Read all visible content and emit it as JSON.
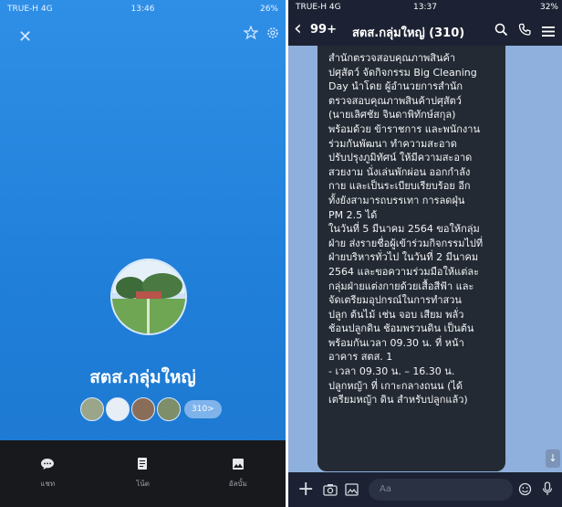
{
  "left": {
    "status": {
      "carrier": "TRUE-H 4G",
      "time": "13:46",
      "battery": "26%"
    },
    "group_name": "สตส.กลุ่มใหญ่",
    "member_count": "310>",
    "bottom_tabs": [
      {
        "label": "แชท",
        "icon": "chat-bubble-icon"
      },
      {
        "label": "โน้ต",
        "icon": "note-icon"
      },
      {
        "label": "อัลบั้ม",
        "icon": "album-icon"
      }
    ]
  },
  "right": {
    "status": {
      "carrier": "TRUE-H 4G",
      "time": "13:37",
      "battery": "32%"
    },
    "header": {
      "unread": "99+",
      "title": "สตส.กลุ่มใหญ่ (310)"
    },
    "message": "สำนักตรวจสอบคุณภาพสินค้า\nปศุสัตว์ จัดกิจกรรม Big Cleaning\nDay นำโดย ผู้อำนวยการสำนัก\nตรวจสอบคุณภาพสินค้าปศุสัตว์\n(นายเลิศชัย จินดาพิทักษ์สกุล)\nพร้อมด้วย ข้าราชการ และพนักงาน\nร่วมกันพัฒนา ทำความสะอาด\nปรับปรุงภูมิทัศน์ ให้มีความสะอาด\nสวยงาม นั่งเล่นพักผ่อน ออกกำลัง\nกาย และเป็นระเบียบเรียบร้อย อีก\nทั้งยังสามารถบรรเทา การลดฝุ่น\nPM 2.5 ได้\nในวันที่ 5 มีนาคม 2564 ขอให้กลุ่ม\nฝ่าย ส่งรายชื่อผู้เข้าร่วมกิจกรรมไปที่\nฝ่ายบริหารทั่วไป ในวันที่ 2 มีนาคม\n2564 และขอความร่วมมือให้แต่ละ\nกลุ่มฝ่ายแต่งกายด้วยเสื้อสีฟ้า และ\nจัดเตรียมอุปกรณ์ในการทำสวน\nปลูก ต้นไม้ เช่น จอบ เสียม พลั่ว\nช้อนปลูกดิน ช้อมพรวนดิน เป็นต้น\nพร้อมกันเวลา 09.30 น. ที่ หน้า\nอาคาร สตส. 1\n- เวลา 09.30 น. – 16.30 น.\nปลูกหญ้า ที่ เกาะกลางถนน (ได้\nเตรียมหญ้า ดิน สำหรับปลูกแล้ว)",
    "input_placeholder": "Aa"
  },
  "colors": {
    "line_blue": "#1f7ed8",
    "dark_bar": "#1c2233",
    "bubble": "#242a33",
    "chat_bg": "#8fb0dc"
  }
}
